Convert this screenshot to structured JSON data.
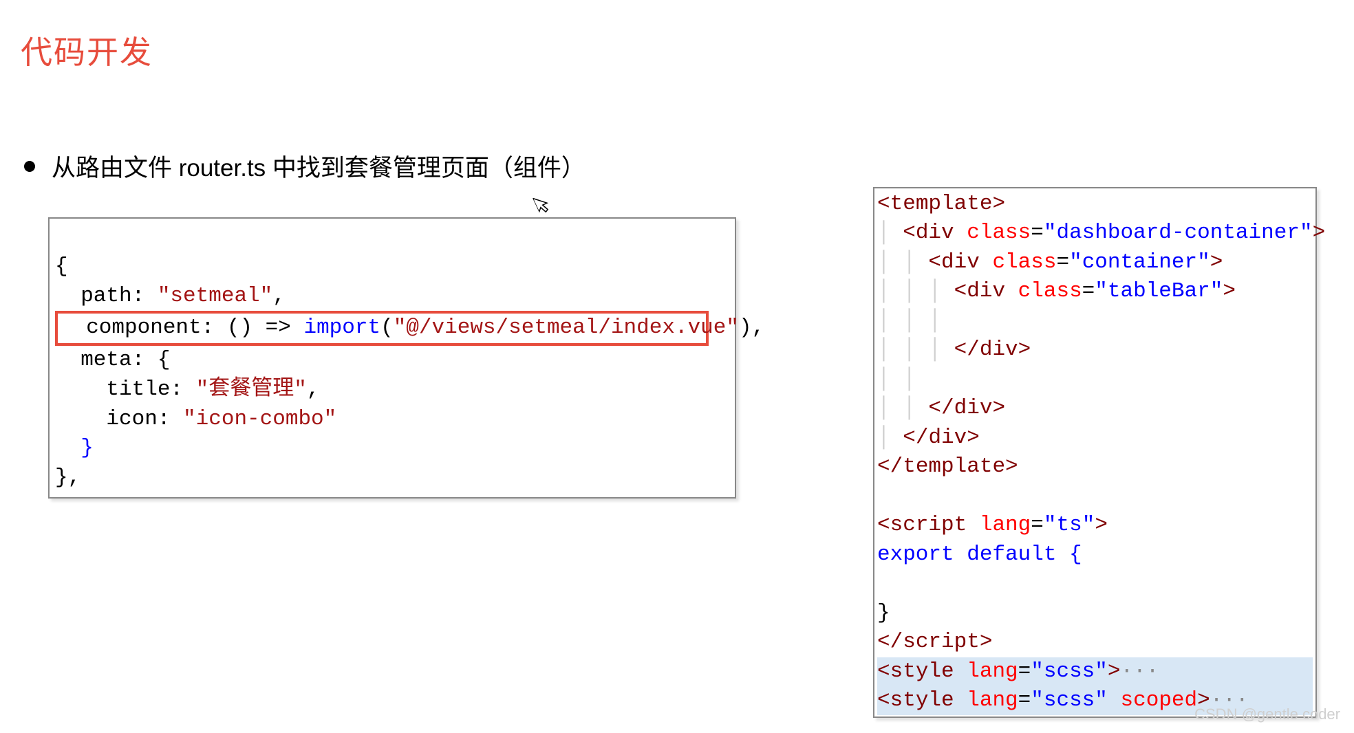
{
  "heading": "代码开发",
  "bullet": "从路由文件 router.ts 中找到套餐管理页面（组件）",
  "left_code": {
    "l1": "{",
    "l2_pre": "  path: ",
    "l2_str": "\"setmeal\"",
    "l2_post": ",",
    "l3_pre": "  component: () => ",
    "l3_kw": "import",
    "l3_mid": "(",
    "l3_str": "\"@/views/setmeal/index.vue\"",
    "l3_post": "),",
    "l4": "  meta: {",
    "l5_pre": "    title: ",
    "l5_str": "\"套餐管理\"",
    "l5_post": ",",
    "l6_pre": "    icon: ",
    "l6_str": "\"icon-combo\"",
    "l7": "  }",
    "l8": "},"
  },
  "right_code": {
    "tag_template": "template",
    "tag_div": "div",
    "attr_class": "class",
    "val_dashboard": "dashboard-container",
    "val_container": "container",
    "val_tablebar": "tableBar",
    "tag_script": "script",
    "attr_lang": "lang",
    "val_ts": "ts",
    "export_line": "export default {",
    "close_brace": "}",
    "tag_style": "style",
    "val_scss": "scss",
    "attr_scoped": "scoped",
    "fold": "···"
  },
  "watermark": "CSDN @gentle coder"
}
